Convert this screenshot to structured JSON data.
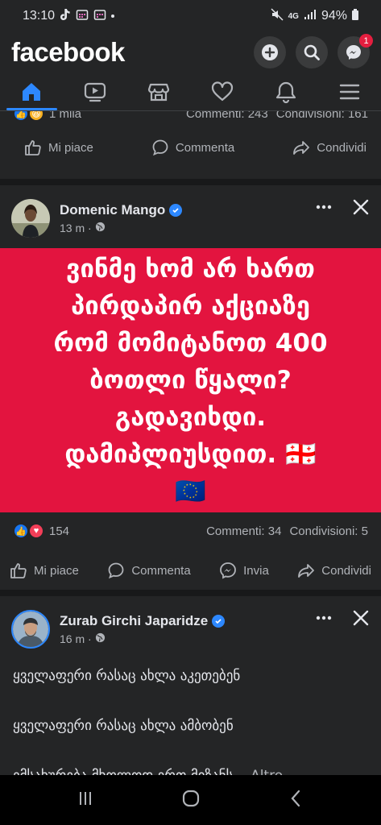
{
  "status_bar": {
    "time": "13:10",
    "battery": "94%",
    "network": "4G"
  },
  "app": {
    "brand": "facebook",
    "messenger_badge": "1",
    "colors": {
      "accent": "#2d88ff",
      "banner": "#e3143f",
      "background": "#18191a",
      "surface": "#242526"
    }
  },
  "tabs": [
    {
      "name": "home",
      "icon": "home-icon",
      "active": true
    },
    {
      "name": "video",
      "icon": "video-icon",
      "active": false
    },
    {
      "name": "marketplace",
      "icon": "marketplace-icon",
      "active": false
    },
    {
      "name": "dating",
      "icon": "heart-icon",
      "active": false
    },
    {
      "name": "notifications",
      "icon": "bell-icon",
      "active": false
    },
    {
      "name": "menu",
      "icon": "hamburger-icon",
      "active": false
    }
  ],
  "post0": {
    "reactions_count": "1 mila",
    "comments": "Commenti: 243",
    "shares": "Condivisioni: 161",
    "actions": {
      "like": "Mi piace",
      "comment": "Commenta",
      "share": "Condividi"
    }
  },
  "post1": {
    "author": "Domenic Mango",
    "time": "13 m ·",
    "banner_lines": [
      "ვინმე ხომ არ ხართ",
      "პირდაპირ აქციაზე",
      "რომ მომიტანოთ 400",
      "ბოთლი წყალი?",
      "გადავიხდი.",
      "დამიპლიუსდით. 🇬🇪",
      "🇪🇺"
    ],
    "reactions_count": "154",
    "comments": "Commenti: 34",
    "shares": "Condivisioni: 5",
    "actions": {
      "like": "Mi piace",
      "comment": "Commenta",
      "send": "Invia",
      "share": "Condividi"
    }
  },
  "post2": {
    "author": "Zurab Girchi Japaridze",
    "time": "16 m ·",
    "lines": [
      "ყველაფერი რასაც ახლა აკეთებენ",
      "ყველაფერი რასაც ახლა ამბობენ",
      "ემსახურება მხოლოდ ერთ მიზანს..."
    ],
    "see_more": "Altro..."
  }
}
